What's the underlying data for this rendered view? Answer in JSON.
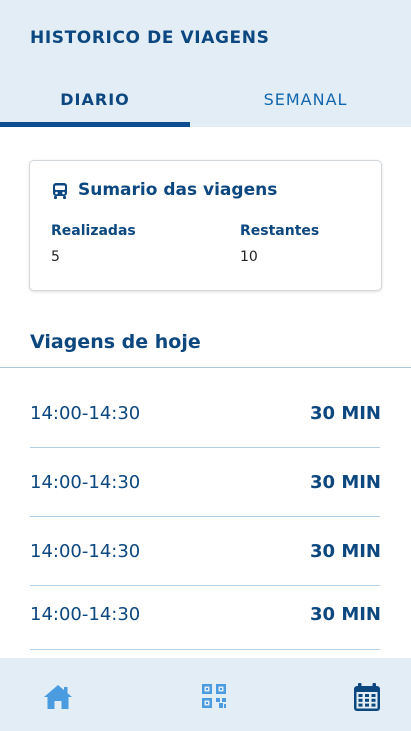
{
  "header": {
    "title": "HISTORICO DE VIAGENS",
    "tabs": [
      {
        "label": "DIARIO",
        "active": true
      },
      {
        "label": "SEMANAL",
        "active": false
      }
    ]
  },
  "summary": {
    "icon": "bus-icon",
    "title": "Sumario das viagens",
    "completed_label": "Realizadas",
    "completed_value": "5",
    "remaining_label": "Restantes",
    "remaining_value": "10"
  },
  "today": {
    "title": "Viagens de hoje",
    "trips": [
      {
        "time": "14:00-14:30",
        "duration": "30 MIN"
      },
      {
        "time": "14:00-14:30",
        "duration": "30 MIN"
      },
      {
        "time": "14:00-14:30",
        "duration": "30 MIN"
      },
      {
        "time": "14:00-14:30",
        "duration": "30 MIN"
      }
    ]
  },
  "bottom_nav": {
    "items": [
      {
        "icon": "home-icon",
        "active": false
      },
      {
        "icon": "qr-code-icon",
        "active": false
      },
      {
        "icon": "calendar-icon",
        "active": true
      }
    ]
  },
  "colors": {
    "primary": "#0c477f",
    "accent": "#1266ad",
    "inactive_icon": "#4a9be0",
    "header_bg": "#e3edf6"
  }
}
